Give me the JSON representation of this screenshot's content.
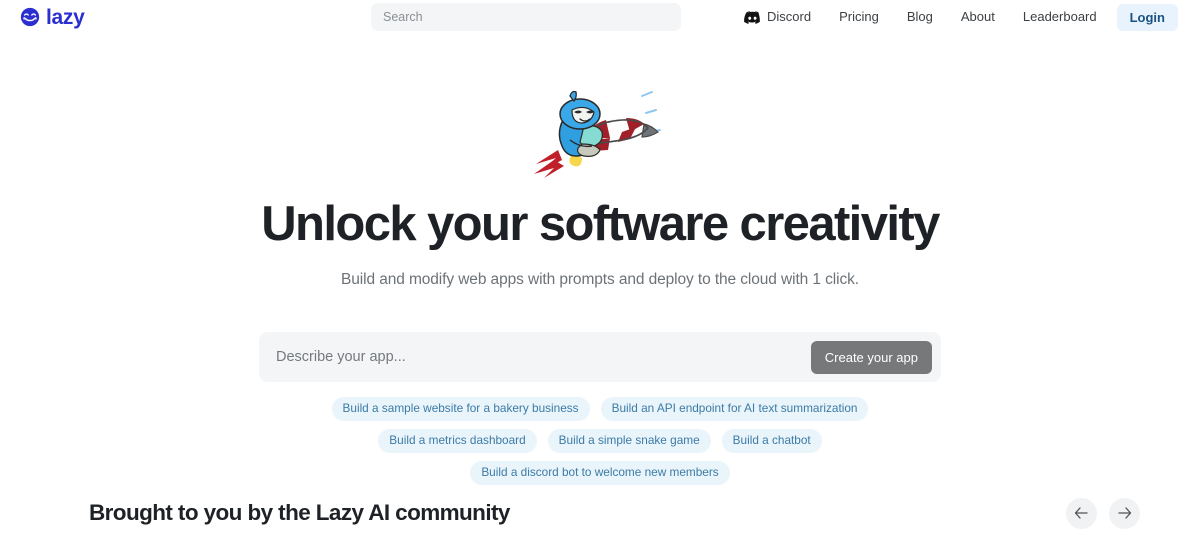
{
  "brand": {
    "name": "lazy",
    "logo_icon": "sleepy-face-logo",
    "color": "#2b2fcf"
  },
  "search": {
    "placeholder": "Search",
    "value": ""
  },
  "nav": {
    "items": [
      {
        "label": "Discord",
        "icon": "discord-icon"
      },
      {
        "label": "Pricing",
        "icon": ""
      },
      {
        "label": "Blog",
        "icon": ""
      },
      {
        "label": "About",
        "icon": ""
      },
      {
        "label": "Leaderboard",
        "icon": ""
      }
    ],
    "login_label": "Login",
    "login_bg": "#e8f3fd",
    "login_color": "#1a5383"
  },
  "hero": {
    "illustration": "sloth-riding-rocket",
    "title": "Unlock your software creativity",
    "subtitle": "Build and modify web apps with prompts and deploy to the cloud with 1 click."
  },
  "prompt": {
    "placeholder": "Describe your app...",
    "value": "",
    "button_label": "Create your app",
    "button_bg": "#77787a"
  },
  "suggestions": {
    "chip_bg": "#e9f4fb",
    "chip_color": "#3c7ba6",
    "items": [
      "Build a sample website for a bakery business",
      "Build an API endpoint for AI text summarization",
      "Build a metrics dashboard",
      "Build a simple snake game",
      "Build a chatbot",
      "Build a discord bot to welcome new members"
    ]
  },
  "community": {
    "title": "Brought to you by the Lazy AI community",
    "prev_icon": "arrow-left-icon",
    "next_icon": "arrow-right-icon",
    "prev_glyph": "←",
    "next_glyph": "→"
  }
}
